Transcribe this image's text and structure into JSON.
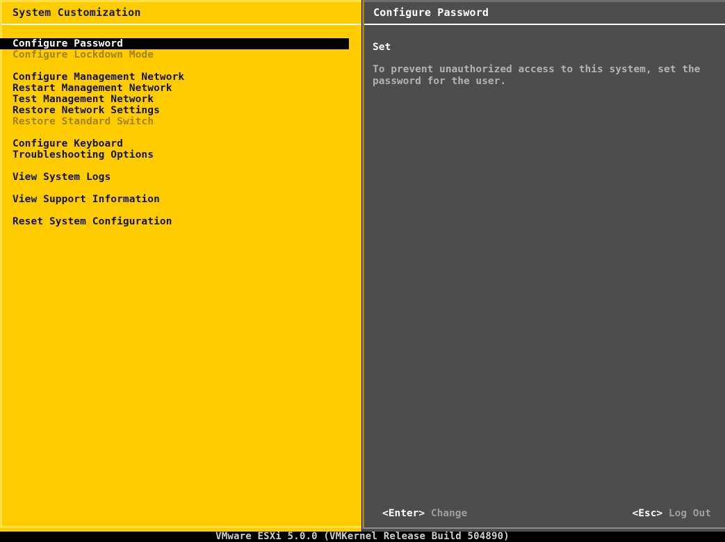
{
  "colors": {
    "panel_yellow": "#ffcc00",
    "panel_gray": "#4d4d4d",
    "selection_bg": "#000000",
    "selection_fg": "#ffffff",
    "disabled_fg": "#a38300",
    "body_text_gray": "#b3b3b3",
    "status_bar_bg": "#000000"
  },
  "left_panel": {
    "title": "System Customization",
    "menu": [
      {
        "label": "Configure Password",
        "state": "selected"
      },
      {
        "label": "Configure Lockdown Mode",
        "state": "disabled"
      },
      {
        "label": "",
        "state": "gap"
      },
      {
        "label": "Configure Management Network",
        "state": "normal"
      },
      {
        "label": "Restart Management Network",
        "state": "normal"
      },
      {
        "label": "Test Management Network",
        "state": "normal"
      },
      {
        "label": "Restore Network Settings",
        "state": "normal"
      },
      {
        "label": "Restore Standard Switch",
        "state": "disabled"
      },
      {
        "label": "",
        "state": "gap"
      },
      {
        "label": "Configure Keyboard",
        "state": "normal"
      },
      {
        "label": "Troubleshooting Options",
        "state": "normal"
      },
      {
        "label": "",
        "state": "gap"
      },
      {
        "label": "View System Logs",
        "state": "normal"
      },
      {
        "label": "",
        "state": "gap"
      },
      {
        "label": "View Support Information",
        "state": "normal"
      },
      {
        "label": "",
        "state": "gap"
      },
      {
        "label": "Reset System Configuration",
        "state": "normal"
      }
    ]
  },
  "right_panel": {
    "title": "Configure Password",
    "heading": "Set",
    "description_line1": "To prevent unauthorized access to this system, set the",
    "description_line2": "password for the user.",
    "footer": {
      "left_key": "<Enter>",
      "left_label": "Change",
      "right_key": "<Esc>",
      "right_label": "Log Out"
    }
  },
  "status_bar": {
    "text": "VMware ESXi 5.0.0 (VMKernel Release Build 504890)"
  }
}
